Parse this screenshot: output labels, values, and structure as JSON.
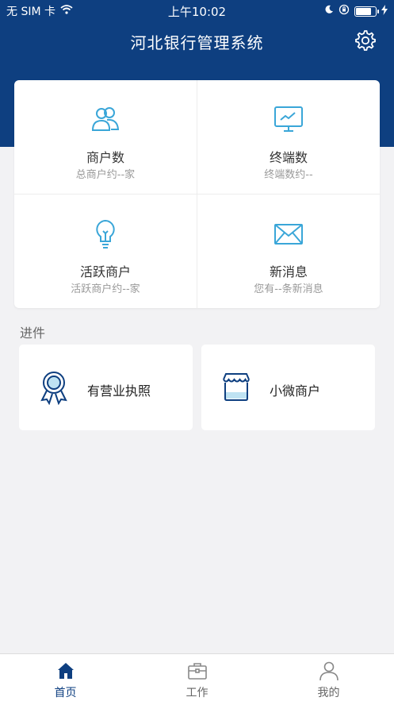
{
  "status_bar": {
    "carrier": "无 SIM 卡",
    "time": "上午10:02"
  },
  "header": {
    "title": "河北银行管理系统"
  },
  "stats": [
    {
      "title": "商户数",
      "subtitle": "总商户约--家",
      "icon": "merchants-icon"
    },
    {
      "title": "终端数",
      "subtitle": "终端数约--",
      "icon": "monitor-icon"
    },
    {
      "title": "活跃商户",
      "subtitle": "活跃商户约--家",
      "icon": "lightbulb-icon"
    },
    {
      "title": "新消息",
      "subtitle": "您有--条新消息",
      "icon": "envelope-icon"
    }
  ],
  "section": {
    "label": "进件"
  },
  "processes": [
    {
      "label": "有营业执照",
      "icon": "award-badge-icon"
    },
    {
      "label": "小微商户",
      "icon": "storefront-icon"
    }
  ],
  "tabs": [
    {
      "label": "首页",
      "icon": "home-icon",
      "active": true
    },
    {
      "label": "工作",
      "icon": "briefcase-icon",
      "active": false
    },
    {
      "label": "我的",
      "icon": "user-icon",
      "active": false
    }
  ],
  "colors": {
    "primary": "#0e3f80",
    "accent_icon": "#3aa6d8",
    "background": "#f2f2f4"
  }
}
